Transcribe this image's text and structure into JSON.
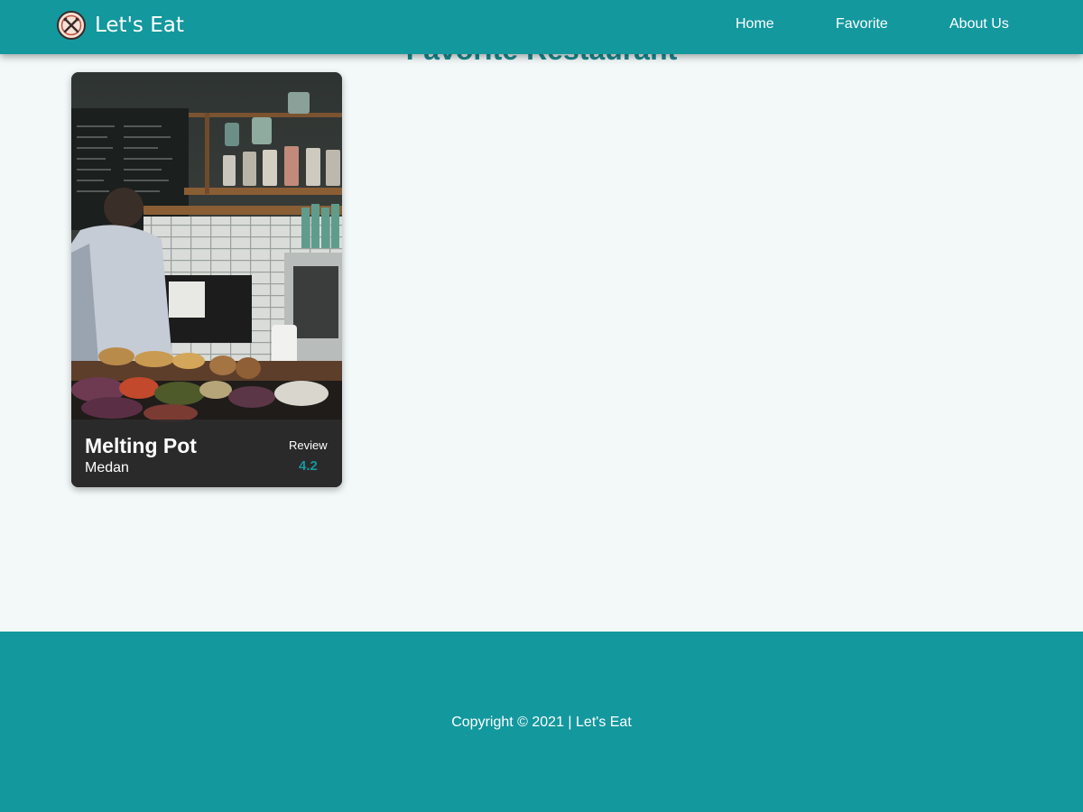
{
  "nav": {
    "brand": "Let's Eat",
    "logo_icon": "crossed-utensils-icon",
    "links": [
      "Home",
      "Favorite",
      "About Us"
    ]
  },
  "main": {
    "title": "Favorite Restaurant",
    "restaurants": [
      {
        "name": "Melting Pot",
        "city": "Medan",
        "review_label": "Review",
        "rating": "4.2"
      }
    ]
  },
  "footer": {
    "copyright": "Copyright © 2021 | Let's Eat"
  },
  "colors": {
    "primary": "#13989e",
    "background": "#f3f9f9",
    "card_overlay": "#2c2c2c",
    "text_light": "#ffffff"
  }
}
